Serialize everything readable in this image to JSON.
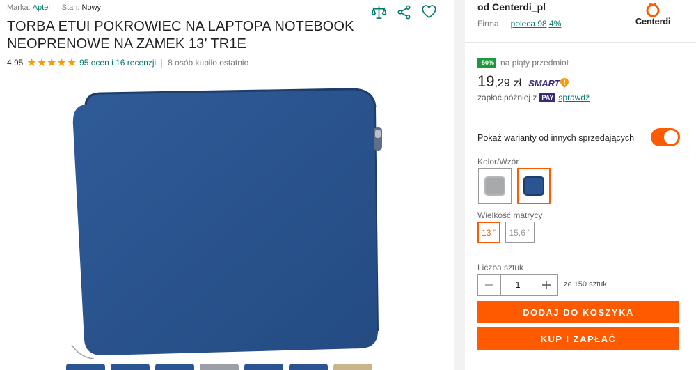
{
  "meta": {
    "brand_label": "Marka:",
    "brand_value": "Aptel",
    "condition_label": "Stan:",
    "condition_value": "Nowy"
  },
  "icons": [
    "compare-icon",
    "share-icon",
    "heart-icon"
  ],
  "product": {
    "title": "TORBA ETUI POKROWIEC NA LAPTOPA NOTEBOOK NEOPRENOWE NA ZAMEK 13’ TR1E",
    "rating": "4,95",
    "stars": "★★★★★",
    "reviews": "95 ocen i 16 recenzji",
    "bought": "8 osób kupiło ostatnio",
    "image_color": "#2b5592"
  },
  "seller": {
    "name": "od Centerdi_pl",
    "type": "Firma",
    "recommend": "poleca 98,4%",
    "logo_text": "Centerdi"
  },
  "offer": {
    "badge": "-50%",
    "promo_text": "na piąty przedmiot",
    "price_int": "19",
    "price_dec": ",29",
    "currency": "zł",
    "smart": "SMART",
    "paylater_prefix": "zapłać później z",
    "pay_badge": "PAY",
    "paylater_link": "sprawdź"
  },
  "variants": {
    "toggle_label": "Pokaż warianty od innych sprzedających",
    "toggle_on": true,
    "color_label": "Kolor/Wzór",
    "size_label": "Wielkość matrycy",
    "sizes": [
      "13 \"",
      "15,6 \""
    ]
  },
  "quantity": {
    "label": "Liczba sztuk",
    "value": "1",
    "stock": "ze 150 sztuk"
  },
  "buttons": {
    "add_to_cart": "DODAJ DO KOSZYKA",
    "buy_now": "KUP I ZAPŁAĆ"
  },
  "colors": {
    "accent": "#ff5a00",
    "link": "#00796b"
  }
}
